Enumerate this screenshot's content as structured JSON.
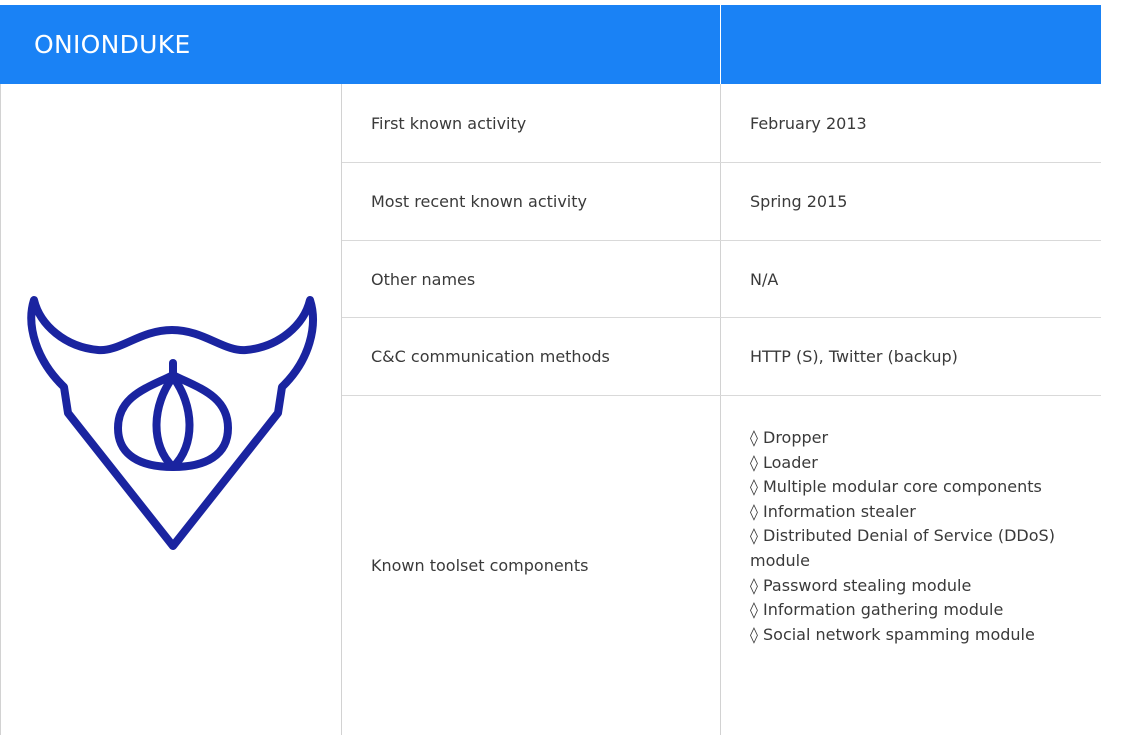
{
  "header": {
    "title": "ONIONDUKE"
  },
  "logo": {
    "icon": "horned-shield-onion-icon",
    "color": "#1a24a0"
  },
  "colors": {
    "header_bg": "#1a82f5",
    "header_text": "#ffffff",
    "grid_line": "#d9d9d9"
  },
  "rows": [
    {
      "label": "First known activity",
      "value": "February 2013"
    },
    {
      "label": "Most recent known activity",
      "value": "Spring 2015"
    },
    {
      "label": "Other names",
      "value": "N/A"
    },
    {
      "label": "C&C communication methods",
      "value": "HTTP (S), Twitter (backup)"
    }
  ],
  "components": {
    "label": "Known toolset components",
    "items": [
      "◊ Dropper",
      "◊ Loader",
      "◊ Multiple modular core components",
      "◊ Information stealer",
      "◊ Distributed Denial of Service (DDoS) module",
      "◊ Password stealing module",
      "◊ Information gathering module",
      "◊ Social network spamming module"
    ]
  }
}
